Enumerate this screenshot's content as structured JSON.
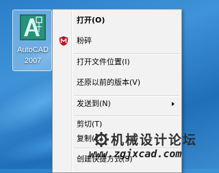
{
  "desktop": {
    "icon": {
      "name": "autocad-2007-shortcut",
      "label_line1": "AutoCAD",
      "label_line2": "2007"
    }
  },
  "context_menu": {
    "items": [
      {
        "label": "打开(O)",
        "bold": true
      },
      {
        "label": "粉碎",
        "icon": "mcafee-shield-icon"
      },
      {
        "label": "打开文件位置(I)"
      },
      {
        "label": "还原以前的版本(V)"
      },
      {
        "label": "发送到(N)",
        "submenu": true
      },
      {
        "label": "剪切(T)"
      },
      {
        "label": "复制(C)"
      },
      {
        "label": "创建快捷方式(S)"
      }
    ]
  },
  "watermark": {
    "title": "机械设计论坛",
    "url": "www.zgjxcad.com"
  },
  "colors": {
    "desktop_blue": "#2a7fc9",
    "menu_bg": "#f2f2f2",
    "mcafee_red": "#c0101e"
  }
}
